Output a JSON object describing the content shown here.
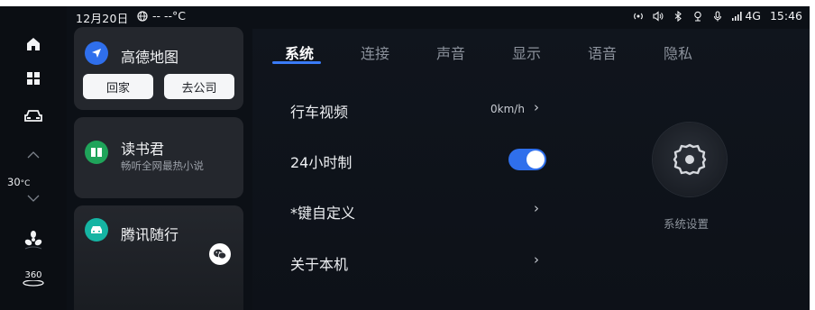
{
  "status": {
    "date": "12月20日",
    "weather": "-- --°C",
    "network": "4G",
    "time": "15:46"
  },
  "rail": {
    "temperature": "30",
    "temperature_unit": "°C",
    "view_label": "360"
  },
  "cards": {
    "map": {
      "title": "高德地图",
      "btn_home": "回家",
      "btn_work": "去公司",
      "accent": "#2f6fec"
    },
    "reader": {
      "title": "读书君",
      "subtitle": "畅听全网最热小说",
      "accent": "#1fa45a"
    },
    "tencent": {
      "title": "腾讯随行",
      "accent": "#15b4a3"
    }
  },
  "settings": {
    "tabs": [
      "系统",
      "连接",
      "声音",
      "显示",
      "语音",
      "隐私"
    ],
    "active_tab": "系统",
    "rows": [
      {
        "label": "行车视频",
        "value": "0km/h"
      },
      {
        "label": "24小时制",
        "toggle_on": true
      },
      {
        "label": "*键自定义"
      },
      {
        "label": "关于本机"
      }
    ],
    "side_label": "系统设置"
  },
  "colors": {
    "accent": "#2f6fec",
    "background": "#0c1016",
    "card": "#24272d"
  }
}
